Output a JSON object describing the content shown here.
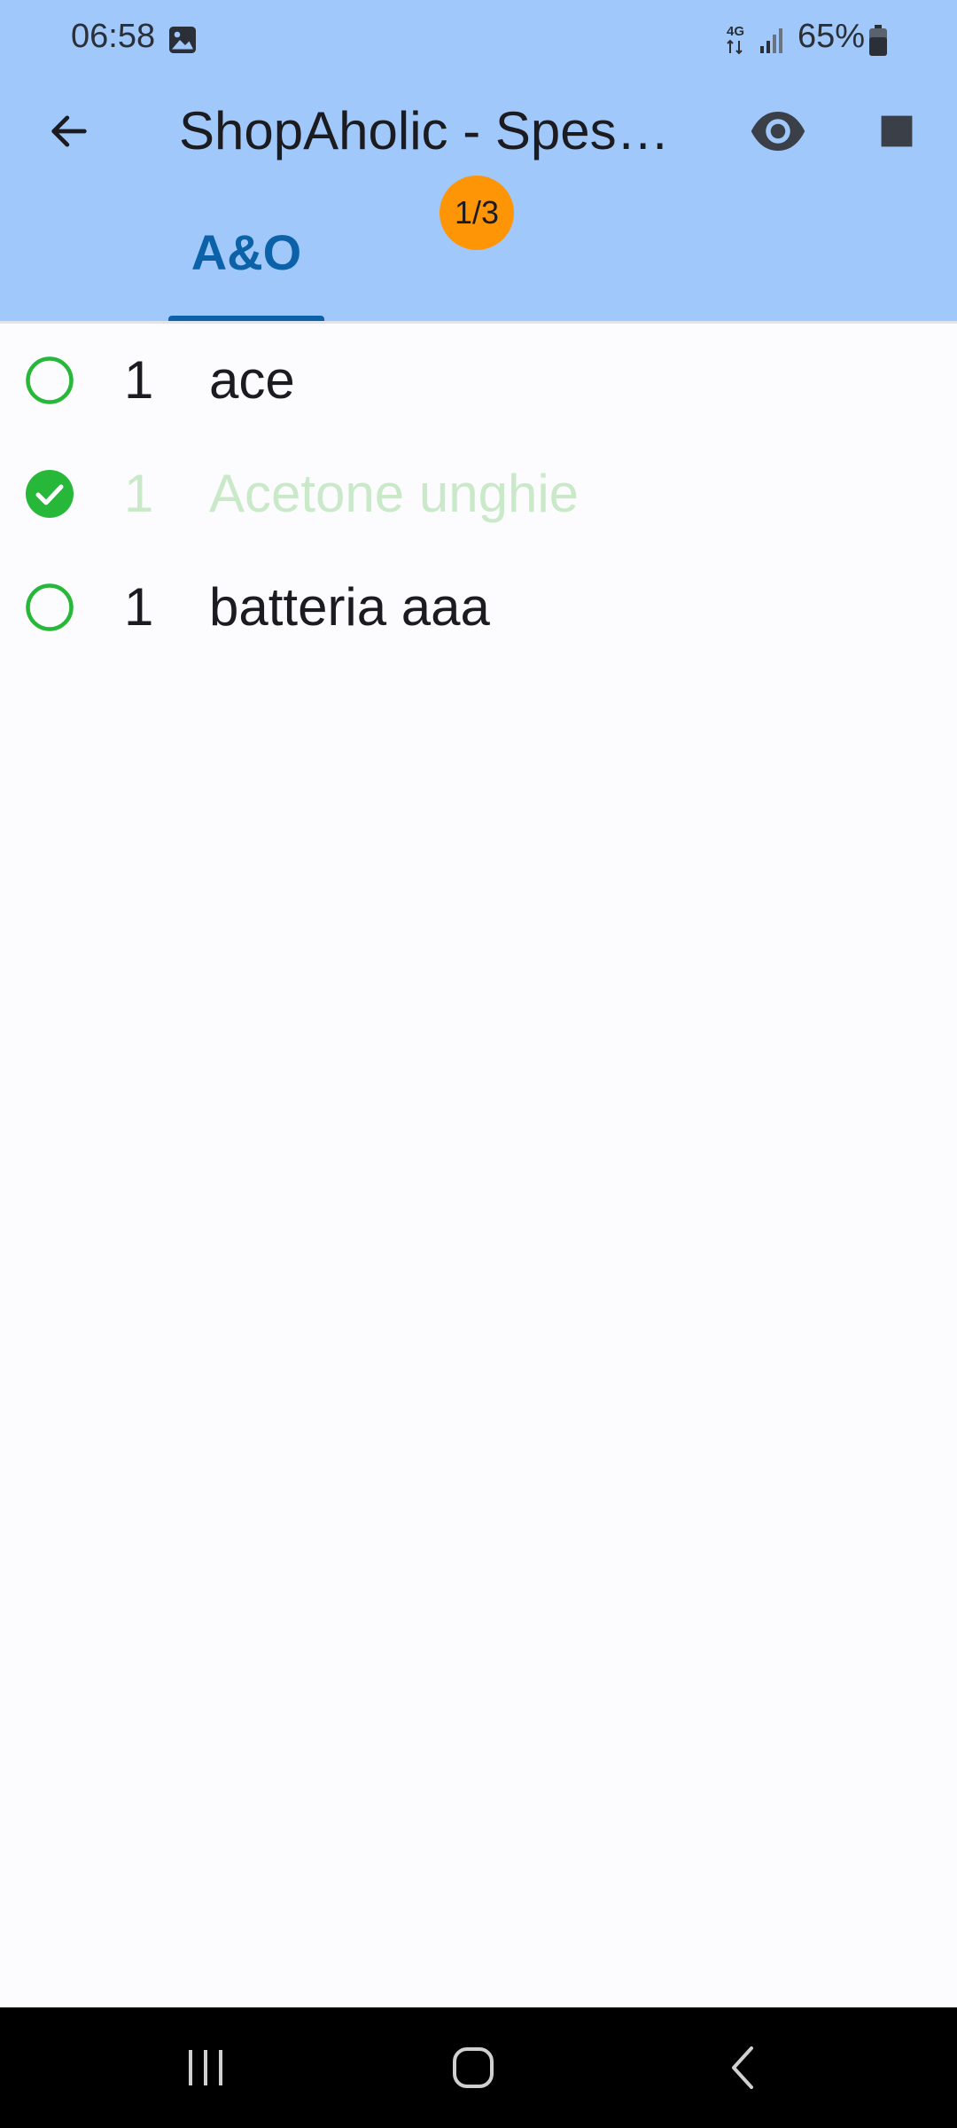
{
  "status_bar": {
    "time": "06:58",
    "network": "4G",
    "battery_percent": "65%",
    "battery_level": 0.65
  },
  "toolbar": {
    "title": "ShopAholic - Spes…"
  },
  "tabs": [
    {
      "label": "A&O",
      "badge": "1/3",
      "selected": true
    }
  ],
  "items": [
    {
      "qty": "1",
      "name": "ace",
      "checked": false
    },
    {
      "qty": "1",
      "name": "Acetone unghie",
      "checked": true
    },
    {
      "qty": "1",
      "name": "batteria aaa",
      "checked": false
    }
  ],
  "colors": {
    "appbar": "#a0c8fa",
    "accent": "#0b62a8",
    "badge": "#fe9507",
    "check_green": "#27b83a",
    "done_text": "#c9e9c9"
  },
  "icons": {
    "status": [
      "gallery-icon",
      "signal-icon",
      "battery-icon"
    ],
    "toolbar": [
      "back-arrow-icon",
      "eye-icon",
      "stop-icon"
    ],
    "navbar": [
      "recents-icon",
      "home-icon",
      "back-icon"
    ]
  }
}
